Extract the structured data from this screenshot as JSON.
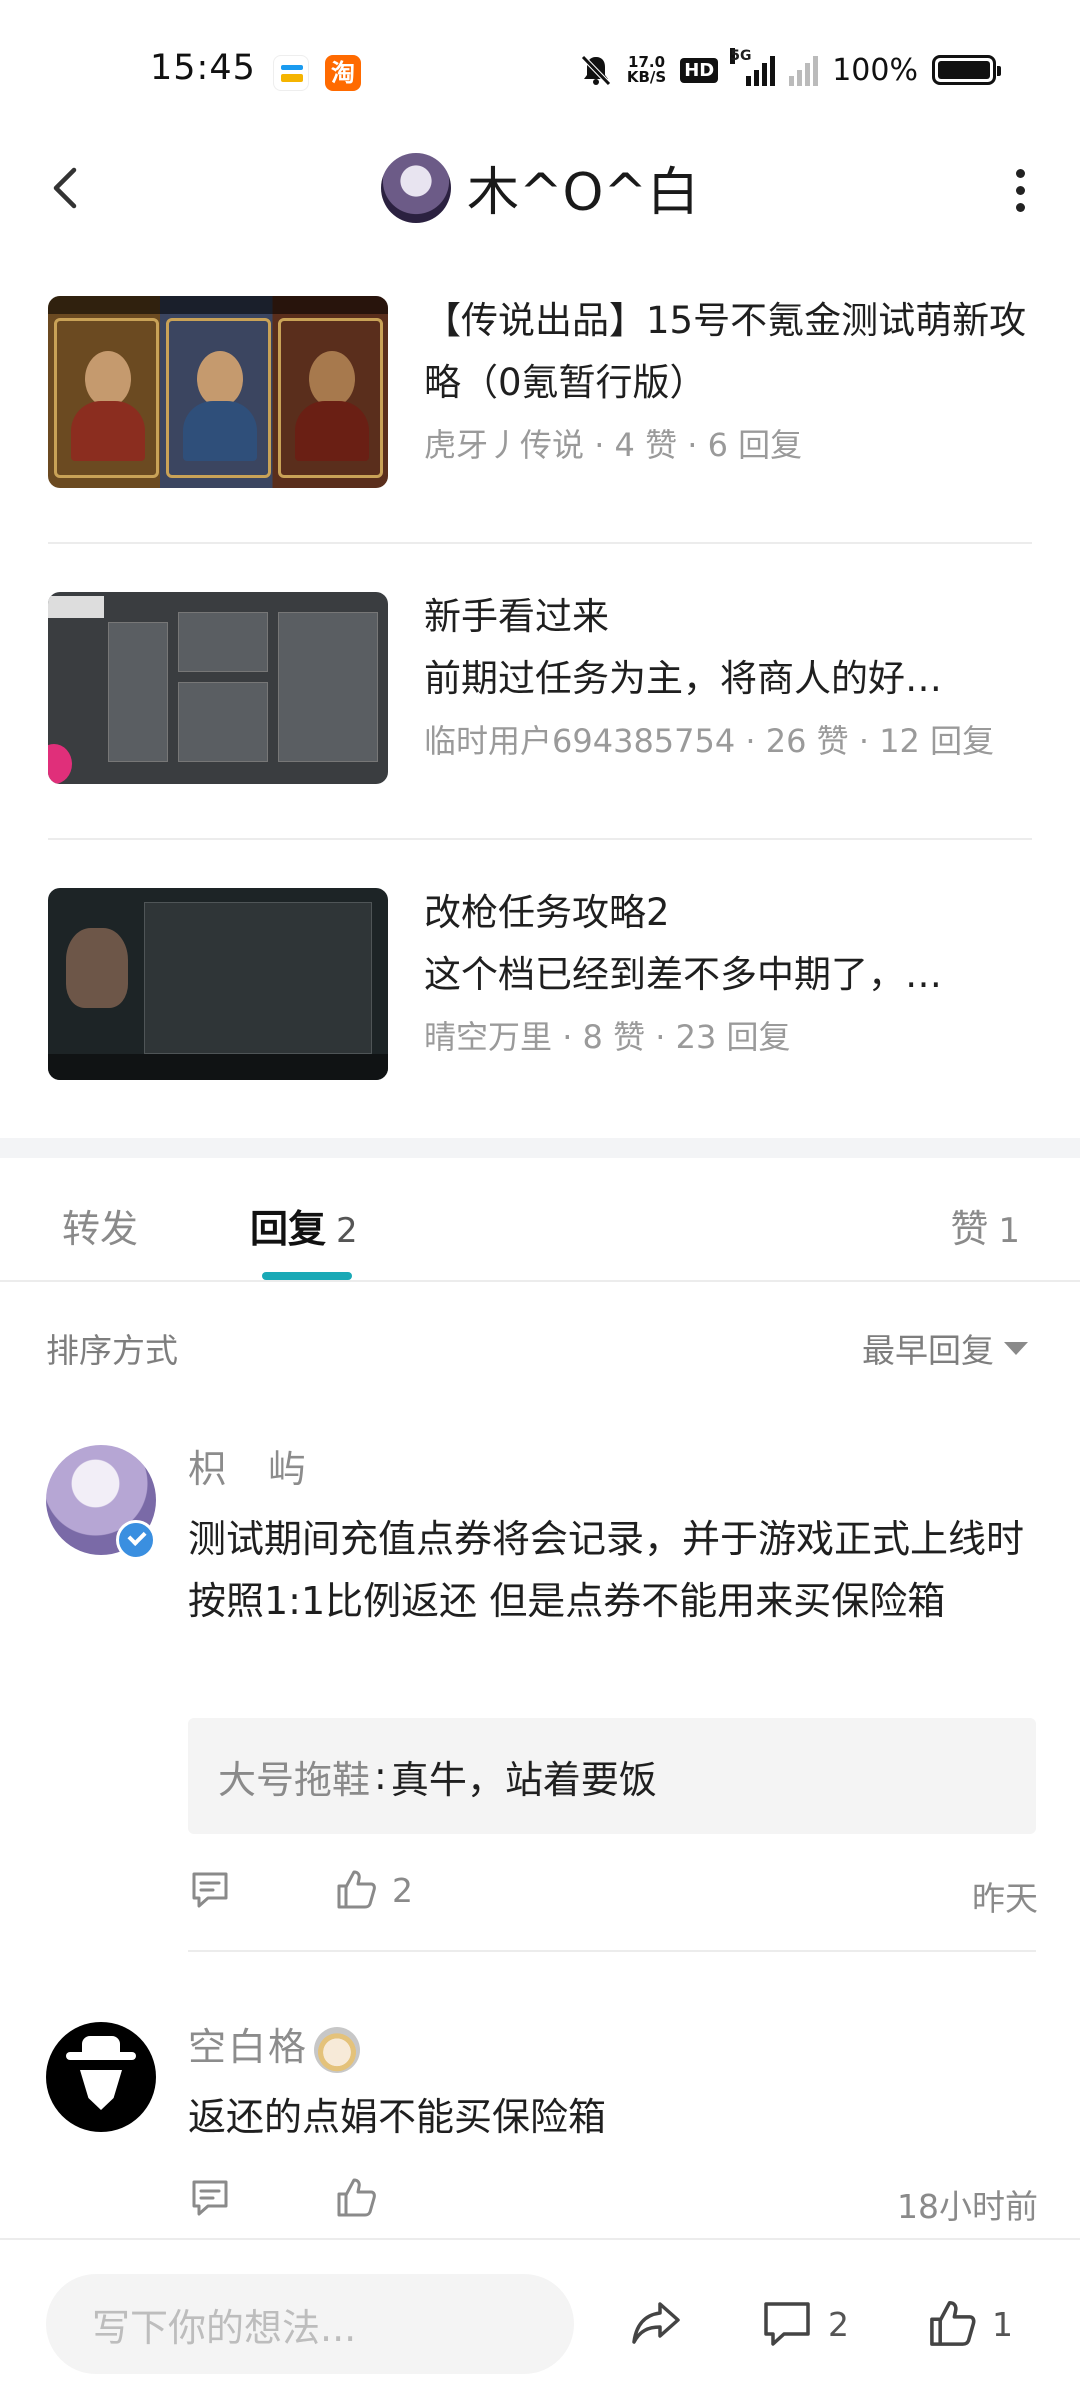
{
  "status_bar": {
    "time": "15:45",
    "net_speed_value": "17.0",
    "net_speed_unit": "KB/S",
    "hd_label": "HD",
    "network_label": "5G",
    "battery": "100%"
  },
  "header": {
    "title": "木^O^白"
  },
  "related_posts": [
    {
      "title": "【传说出品】15号不氪金测试萌新攻略（0氪暂行版）",
      "author": "虎牙丿传说",
      "likes": "4 赞",
      "replies": "6 回复"
    },
    {
      "title": "新手看过来",
      "excerpt": "前期过任务为主，将商人的好…",
      "author": "临时用户694385754",
      "likes": "26 赞",
      "replies": "12 回复"
    },
    {
      "title": "改枪任务攻略2",
      "excerpt": "这个档已经到差不多中期了，…",
      "author": "晴空万里",
      "likes": "8 赞",
      "replies": "23 回复"
    }
  ],
  "meta_separator": "·",
  "tabs": {
    "forward": "转发",
    "reply": "回复",
    "reply_count": "2",
    "like": "赞",
    "like_count": "1"
  },
  "sort": {
    "label": "排序方式",
    "selected": "最早回复"
  },
  "comments": [
    {
      "user": "枳　屿",
      "text": "测试期间充值点券将会记录，并于游戏正式上线时按照1:1比例返还  但是点券不能用来买保险箱",
      "sub_reply": {
        "user": "大号拖鞋",
        "separator": ":",
        "text": "真牛，站着要饭"
      },
      "likes": "2",
      "time": "昨天"
    },
    {
      "user": "空白格",
      "text": "返还的点娟不能买保险箱",
      "likes": "",
      "time": "18小时前"
    }
  ],
  "bottom_bar": {
    "input_placeholder": "写下你的想法...",
    "comment_count": "2",
    "like_count": "1"
  },
  "colors": {
    "accent": "#19a9b6",
    "muted_text": "#8a8a8a",
    "divider": "#ececec"
  }
}
